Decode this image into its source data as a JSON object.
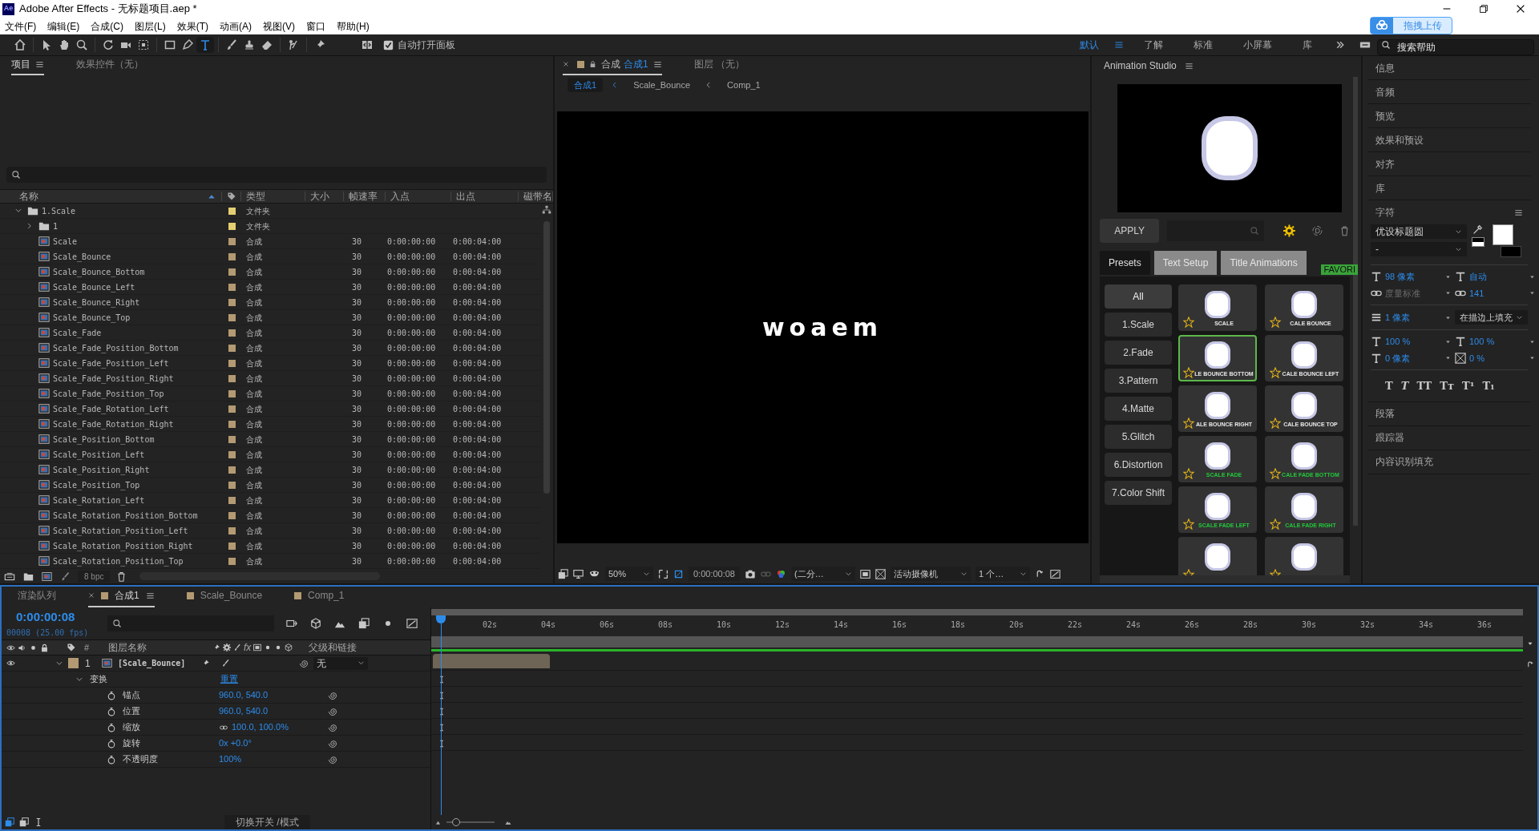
{
  "window": {
    "app_logo": "Ae",
    "title": "Adobe After Effects - 无标题项目.aep *"
  },
  "menu": [
    "文件(F)",
    "编辑(E)",
    "合成(C)",
    "图层(L)",
    "效果(T)",
    "动画(A)",
    "视图(V)",
    "窗口",
    "帮助(H)"
  ],
  "toolbar": {
    "tools": [
      {
        "kind": "home",
        "selected": false
      },
      {
        "kind": "pointer",
        "selected": false
      },
      {
        "kind": "hand",
        "selected": false
      },
      {
        "kind": "magnifier",
        "selected": false
      },
      {
        "kind": "rotate",
        "selected": false
      },
      {
        "kind": "camera",
        "selected": false
      },
      {
        "kind": "dashed",
        "selected": false
      },
      {
        "kind": "rectangle",
        "selected": false
      },
      {
        "kind": "pen",
        "selected": false
      },
      {
        "kind": "text",
        "selected": true
      },
      {
        "kind": "brush",
        "selected": false
      },
      {
        "kind": "stamp",
        "selected": false
      },
      {
        "kind": "eraser",
        "selected": false
      },
      {
        "kind": "roto",
        "selected": false
      },
      {
        "kind": "pin",
        "selected": false
      }
    ],
    "auto_open": {
      "label": "自动打开面板",
      "checked": true
    },
    "workspaces": [
      {
        "label": "默认",
        "selected": true
      },
      {
        "label": "了解",
        "selected": false
      },
      {
        "label": "标准",
        "selected": false
      },
      {
        "label": "小屏幕",
        "selected": false
      },
      {
        "label": "库",
        "selected": false
      }
    ],
    "search": {
      "placeholder": "搜索帮助"
    }
  },
  "upload_button": "拖拽上传",
  "project": {
    "tabs": [
      {
        "label": "项目",
        "selected": true
      },
      {
        "label": "效果控件（无）",
        "selected": false
      }
    ],
    "columns": [
      "名称",
      "类型",
      "大小",
      "帧速率",
      "入点",
      "出点",
      "磁带名"
    ],
    "footer_bpc": "8 bpc",
    "rows": [
      {
        "name": "1.Scale",
        "kind": "folder",
        "type": "文件夹",
        "color": "#e3cf72",
        "expanded": true,
        "children": [
          {
            "name": "1",
            "kind": "folder",
            "type": "文件夹",
            "color": "#e3cf72",
            "expanded": false
          },
          {
            "name": "Scale",
            "kind": "comp",
            "type": "合成",
            "color": "#b39a72",
            "fps": "30",
            "in": "0:00:00:00",
            "out": "0:00:04:00"
          },
          {
            "name": "Scale_Bounce",
            "kind": "comp",
            "type": "合成",
            "color": "#b39a72",
            "fps": "30",
            "in": "0:00:00:00",
            "out": "0:00:04:00"
          },
          {
            "name": "Scale_Bounce_Bottom",
            "kind": "comp",
            "type": "合成",
            "color": "#b39a72",
            "fps": "30",
            "in": "0:00:00:00",
            "out": "0:00:04:00"
          },
          {
            "name": "Scale_Bounce_Left",
            "kind": "comp",
            "type": "合成",
            "color": "#b39a72",
            "fps": "30",
            "in": "0:00:00:00",
            "out": "0:00:04:00"
          },
          {
            "name": "Scale_Bounce_Right",
            "kind": "comp",
            "type": "合成",
            "color": "#b39a72",
            "fps": "30",
            "in": "0:00:00:00",
            "out": "0:00:04:00"
          },
          {
            "name": "Scale_Bounce_Top",
            "kind": "comp",
            "type": "合成",
            "color": "#b39a72",
            "fps": "30",
            "in": "0:00:00:00",
            "out": "0:00:04:00"
          },
          {
            "name": "Scale_Fade",
            "kind": "comp",
            "type": "合成",
            "color": "#b39a72",
            "fps": "30",
            "in": "0:00:00:00",
            "out": "0:00:04:00"
          },
          {
            "name": "Scale_Fade_Position_Bottom",
            "kind": "comp",
            "type": "合成",
            "color": "#b39a72",
            "fps": "30",
            "in": "0:00:00:00",
            "out": "0:00:04:00"
          },
          {
            "name": "Scale_Fade_Position_Left",
            "kind": "comp",
            "type": "合成",
            "color": "#b39a72",
            "fps": "30",
            "in": "0:00:00:00",
            "out": "0:00:04:00"
          },
          {
            "name": "Scale_Fade_Position_Right",
            "kind": "comp",
            "type": "合成",
            "color": "#b39a72",
            "fps": "30",
            "in": "0:00:00:00",
            "out": "0:00:04:00"
          },
          {
            "name": "Scale_Fade_Position_Top",
            "kind": "comp",
            "type": "合成",
            "color": "#b39a72",
            "fps": "30",
            "in": "0:00:00:00",
            "out": "0:00:04:00"
          },
          {
            "name": "Scale_Fade_Rotation_Left",
            "kind": "comp",
            "type": "合成",
            "color": "#b39a72",
            "fps": "30",
            "in": "0:00:00:00",
            "out": "0:00:04:00"
          },
          {
            "name": "Scale_Fade_Rotation_Right",
            "kind": "comp",
            "type": "合成",
            "color": "#b39a72",
            "fps": "30",
            "in": "0:00:00:00",
            "out": "0:00:04:00"
          },
          {
            "name": "Scale_Position_Bottom",
            "kind": "comp",
            "type": "合成",
            "color": "#b39a72",
            "fps": "30",
            "in": "0:00:00:00",
            "out": "0:00:04:00"
          },
          {
            "name": "Scale_Position_Left",
            "kind": "comp",
            "type": "合成",
            "color": "#b39a72",
            "fps": "30",
            "in": "0:00:00:00",
            "out": "0:00:04:00"
          },
          {
            "name": "Scale_Position_Right",
            "kind": "comp",
            "type": "合成",
            "color": "#b39a72",
            "fps": "30",
            "in": "0:00:00:00",
            "out": "0:00:04:00"
          },
          {
            "name": "Scale_Position_Top",
            "kind": "comp",
            "type": "合成",
            "color": "#b39a72",
            "fps": "30",
            "in": "0:00:00:00",
            "out": "0:00:04:00"
          },
          {
            "name": "Scale_Rotation_Left",
            "kind": "comp",
            "type": "合成",
            "color": "#b39a72",
            "fps": "30",
            "in": "0:00:00:00",
            "out": "0:00:04:00"
          },
          {
            "name": "Scale_Rotation_Position_Bottom",
            "kind": "comp",
            "type": "合成",
            "color": "#b39a72",
            "fps": "30",
            "in": "0:00:00:00",
            "out": "0:00:04:00"
          },
          {
            "name": "Scale_Rotation_Position_Left",
            "kind": "comp",
            "type": "合成",
            "color": "#b39a72",
            "fps": "30",
            "in": "0:00:00:00",
            "out": "0:00:04:00"
          },
          {
            "name": "Scale_Rotation_Position_Right",
            "kind": "comp",
            "type": "合成",
            "color": "#b39a72",
            "fps": "30",
            "in": "0:00:00:00",
            "out": "0:00:04:00"
          },
          {
            "name": "Scale_Rotation_Position_Top",
            "kind": "comp",
            "type": "合成",
            "color": "#b39a72",
            "fps": "30",
            "in": "0:00:00:00",
            "out": "0:00:04:00"
          }
        ]
      }
    ]
  },
  "viewer": {
    "tabs": [
      {
        "label": "合成",
        "comp": "合成1",
        "selected": true
      },
      {
        "label": "图层 （无）",
        "selected": false
      }
    ],
    "breadcrumb": [
      {
        "label": "合成1",
        "selected": true
      },
      {
        "label": "Scale_Bounce",
        "selected": false
      },
      {
        "label": "Comp_1",
        "selected": false
      }
    ],
    "canvas_text": "woaem",
    "controls": {
      "zoom": "50%",
      "time": "0:00:00:08",
      "resolution": "(二分…",
      "camera": "活动摄像机",
      "views": "1 个…"
    }
  },
  "animation_studio": {
    "title": "Animation Studio",
    "apply": "APPLY",
    "tabs": [
      {
        "label": "Presets",
        "selected": true
      },
      {
        "label": "Text Setup",
        "selected": false
      },
      {
        "label": "Title Animations",
        "selected": false
      }
    ],
    "favorites_label": "FAVORI",
    "categories": [
      {
        "label": "All",
        "selected": true
      },
      {
        "label": "1.Scale",
        "selected": false
      },
      {
        "label": "2.Fade",
        "selected": false
      },
      {
        "label": "3.Pattern",
        "selected": false
      },
      {
        "label": "4.Matte",
        "selected": false
      },
      {
        "label": "5.Glitch",
        "selected": false
      },
      {
        "label": "6.Distortion",
        "selected": false
      },
      {
        "label": "7.Color Shift",
        "selected": false
      }
    ],
    "presets": [
      {
        "label": "SCALE",
        "color": "#e8e8e8",
        "selected": false
      },
      {
        "label": "CALE BOUNCE",
        "color": "#e8e8e8",
        "selected": false
      },
      {
        "label": "LE BOUNCE BOTTOM",
        "color": "#e8e8e8",
        "selected": true
      },
      {
        "label": "CALE BOUNCE LEFT",
        "color": "#e8e8e8",
        "selected": false
      },
      {
        "label": "ALE BOUNCE RIGHT",
        "color": "#e8e8e8",
        "selected": false
      },
      {
        "label": "CALE BOUNCE TOP",
        "color": "#e8e8e8",
        "selected": false
      },
      {
        "label": "SCALE FADE",
        "color": "#22c83a",
        "selected": false
      },
      {
        "label": "CALE FADE BOTTOM",
        "color": "#22c83a",
        "selected": false
      },
      {
        "label": "SCALE FADE LEFT",
        "color": "#22c83a",
        "selected": false
      },
      {
        "label": "CALE FADE RIGHT",
        "color": "#22c83a",
        "selected": false
      },
      {
        "selected": false
      },
      {
        "selected": false
      }
    ]
  },
  "panels_top": [
    "信息",
    "音频",
    "预览",
    "效果和预设",
    "对齐",
    "库"
  ],
  "character": {
    "title": "字符",
    "font": "优设标题圆",
    "style": "-",
    "size": "98 像素",
    "leading": "自动",
    "kerning": "度量标准",
    "tracking": "141",
    "stroke_width": "1 像素",
    "stroke_mode": "在描边上填充",
    "vertical_scale": "100 %",
    "horizontal_scale": "100 %",
    "baseline": "0 像素",
    "tsume": "0 %",
    "style_buttons": [
      "T",
      "T",
      "TT",
      "Tт",
      "T¹",
      "T₁"
    ]
  },
  "panels_bottom": [
    "段落",
    "跟踪器",
    "内容识别填充"
  ],
  "timeline": {
    "tabs": [
      {
        "label": "渲染队列",
        "selected": false
      },
      {
        "label": "合成1",
        "selected": true,
        "color": "#b39a72"
      },
      {
        "label": "Scale_Bounce",
        "selected": false,
        "color": "#b39a72"
      },
      {
        "label": "Comp_1",
        "selected": false,
        "color": "#b39a72"
      }
    ],
    "timecode": "0:00:00:08",
    "frames": "00008 (25.00 fps)",
    "columns": {
      "number": "#",
      "name": "图层名称",
      "fx": "fx",
      "parent": "父级和链接"
    },
    "layer": {
      "index": "1",
      "name": "[Scale_Bounce]",
      "color": "#b39a72",
      "visible": true,
      "expanded": true,
      "parent": "无"
    },
    "transform": {
      "label": "变换",
      "reset": "重置",
      "expanded": true
    },
    "properties": [
      {
        "name": "锚点",
        "value": "960.0, 540.0",
        "linked": false
      },
      {
        "name": "位置",
        "value": "960.0, 540.0",
        "linked": false
      },
      {
        "name": "缩放",
        "value": "100.0, 100.0%",
        "linked": true
      },
      {
        "name": "旋转",
        "value": "0x +0.0°",
        "linked": false
      },
      {
        "name": "不透明度",
        "value": "100%",
        "linked": false
      }
    ],
    "ruler": [
      "02s",
      "04s",
      "06s",
      "08s",
      "10s",
      "12s",
      "14s",
      "16s",
      "18s",
      "20s",
      "22s",
      "24s",
      "26s",
      "28s",
      "30s",
      "32s",
      "34s",
      "36s"
    ],
    "playhead": {
      "level": 0.009
    },
    "footer": "切换开关 /模式",
    "zoom_slider": {
      "level": 0.2
    }
  }
}
